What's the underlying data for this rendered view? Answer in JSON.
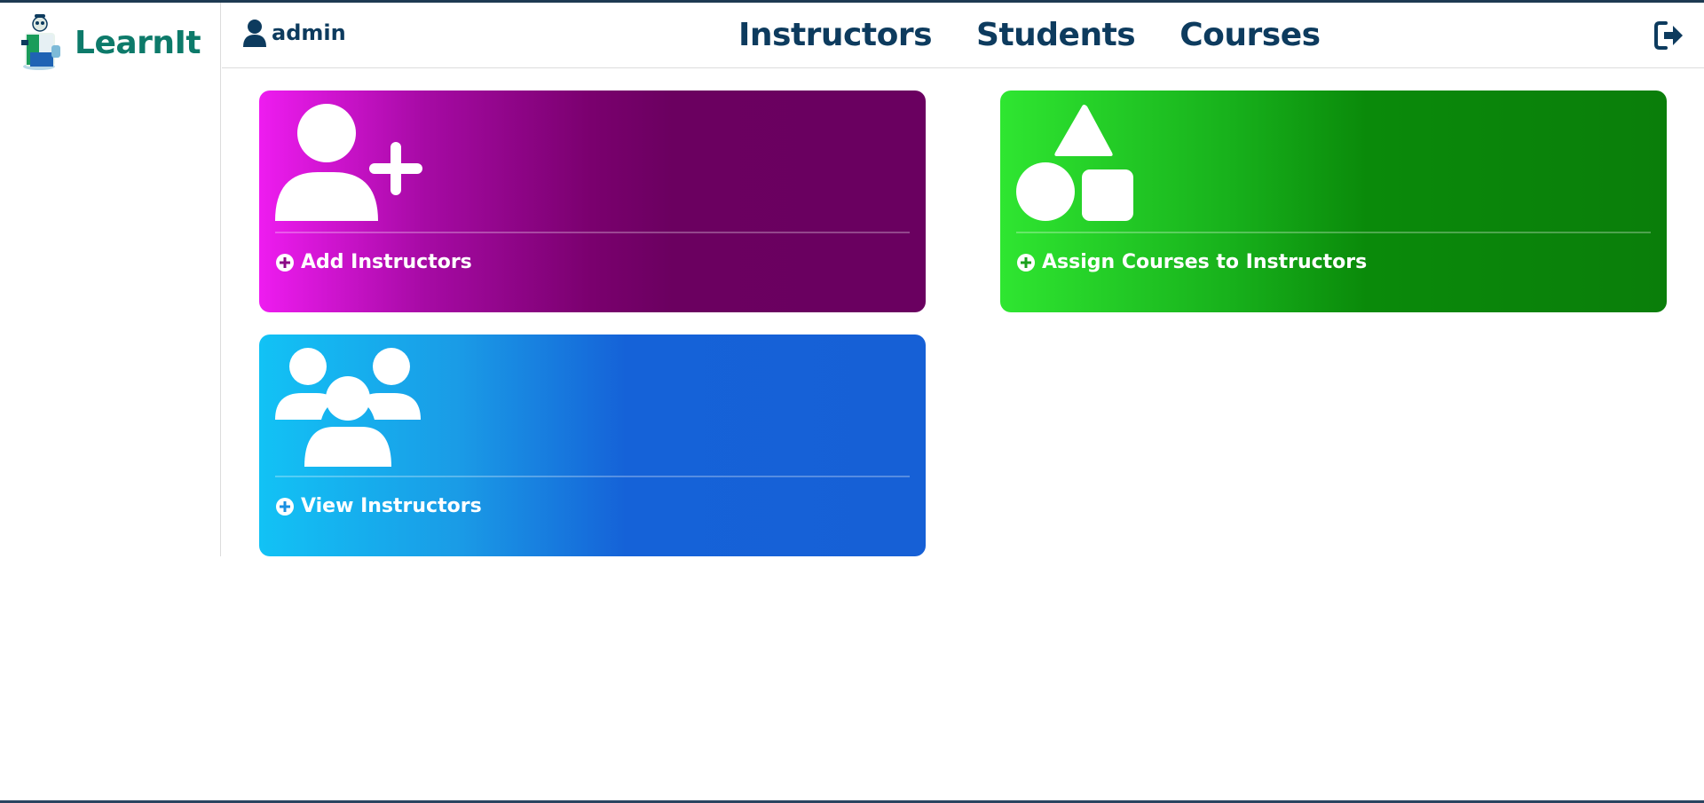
{
  "brand": {
    "name": "LearnIt"
  },
  "user": {
    "name": "admin",
    "icon": "user-icon"
  },
  "nav": {
    "items": [
      {
        "label": "Instructors"
      },
      {
        "label": "Students"
      },
      {
        "label": "Courses"
      }
    ]
  },
  "header": {
    "logout_icon": "logout-icon"
  },
  "cards": [
    {
      "label": "Add Instructors",
      "icon": "user-plus-icon",
      "color_start": "#ee1cf0",
      "color_end": "#6a0060"
    },
    {
      "label": "Assign Courses to Instructors",
      "icon": "shapes-icon",
      "color_start": "#2fe631",
      "color_end": "#0a7e0a"
    },
    {
      "label": "View Instructors",
      "icon": "users-group-icon",
      "color_start": "#12c2f5",
      "color_end": "#1660d6"
    }
  ],
  "colors": {
    "navy": "#0d3b5e",
    "brand_teal": "#0d7a6a"
  }
}
